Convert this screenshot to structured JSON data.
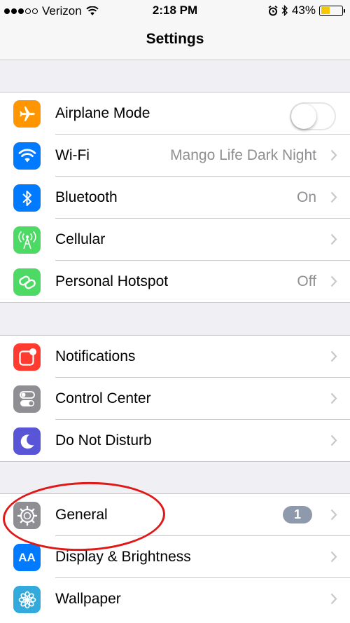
{
  "status_bar": {
    "carrier": "Verizon",
    "time": "2:18 PM",
    "battery": "43%",
    "battery_level": 0.43,
    "battery_color": "#f5c700"
  },
  "nav": {
    "title": "Settings"
  },
  "groups": [
    [
      {
        "label": "Airplane Mode",
        "icon": "airplane-icon",
        "icon_color": "#ff9500",
        "control": "toggle",
        "toggle_on": false
      },
      {
        "label": "Wi-Fi",
        "icon": "wifi-icon",
        "icon_color": "#007aff",
        "value": "Mango Life Dark Night"
      },
      {
        "label": "Bluetooth",
        "icon": "bluetooth-icon",
        "icon_color": "#007aff",
        "value": "On"
      },
      {
        "label": "Cellular",
        "icon": "cellular-icon",
        "icon_color": "#4cd964"
      },
      {
        "label": "Personal Hotspot",
        "icon": "hotspot-icon",
        "icon_color": "#4cd964",
        "value": "Off"
      }
    ],
    [
      {
        "label": "Notifications",
        "icon": "notifications-icon",
        "icon_color": "#ff3b30"
      },
      {
        "label": "Control Center",
        "icon": "control-center-icon",
        "icon_color": "#8e8e93"
      },
      {
        "label": "Do Not Disturb",
        "icon": "moon-icon",
        "icon_color": "#5856d6"
      }
    ],
    [
      {
        "label": "General",
        "icon": "gear-icon",
        "icon_color": "#8e8e93",
        "badge": "1"
      },
      {
        "label": "Display & Brightness",
        "icon": "display-icon",
        "icon_color": "#007aff",
        "icon_text": "AA"
      },
      {
        "label": "Wallpaper",
        "icon": "wallpaper-icon",
        "icon_color": "#34aadc"
      }
    ]
  ],
  "annotation_color": "#e01818"
}
